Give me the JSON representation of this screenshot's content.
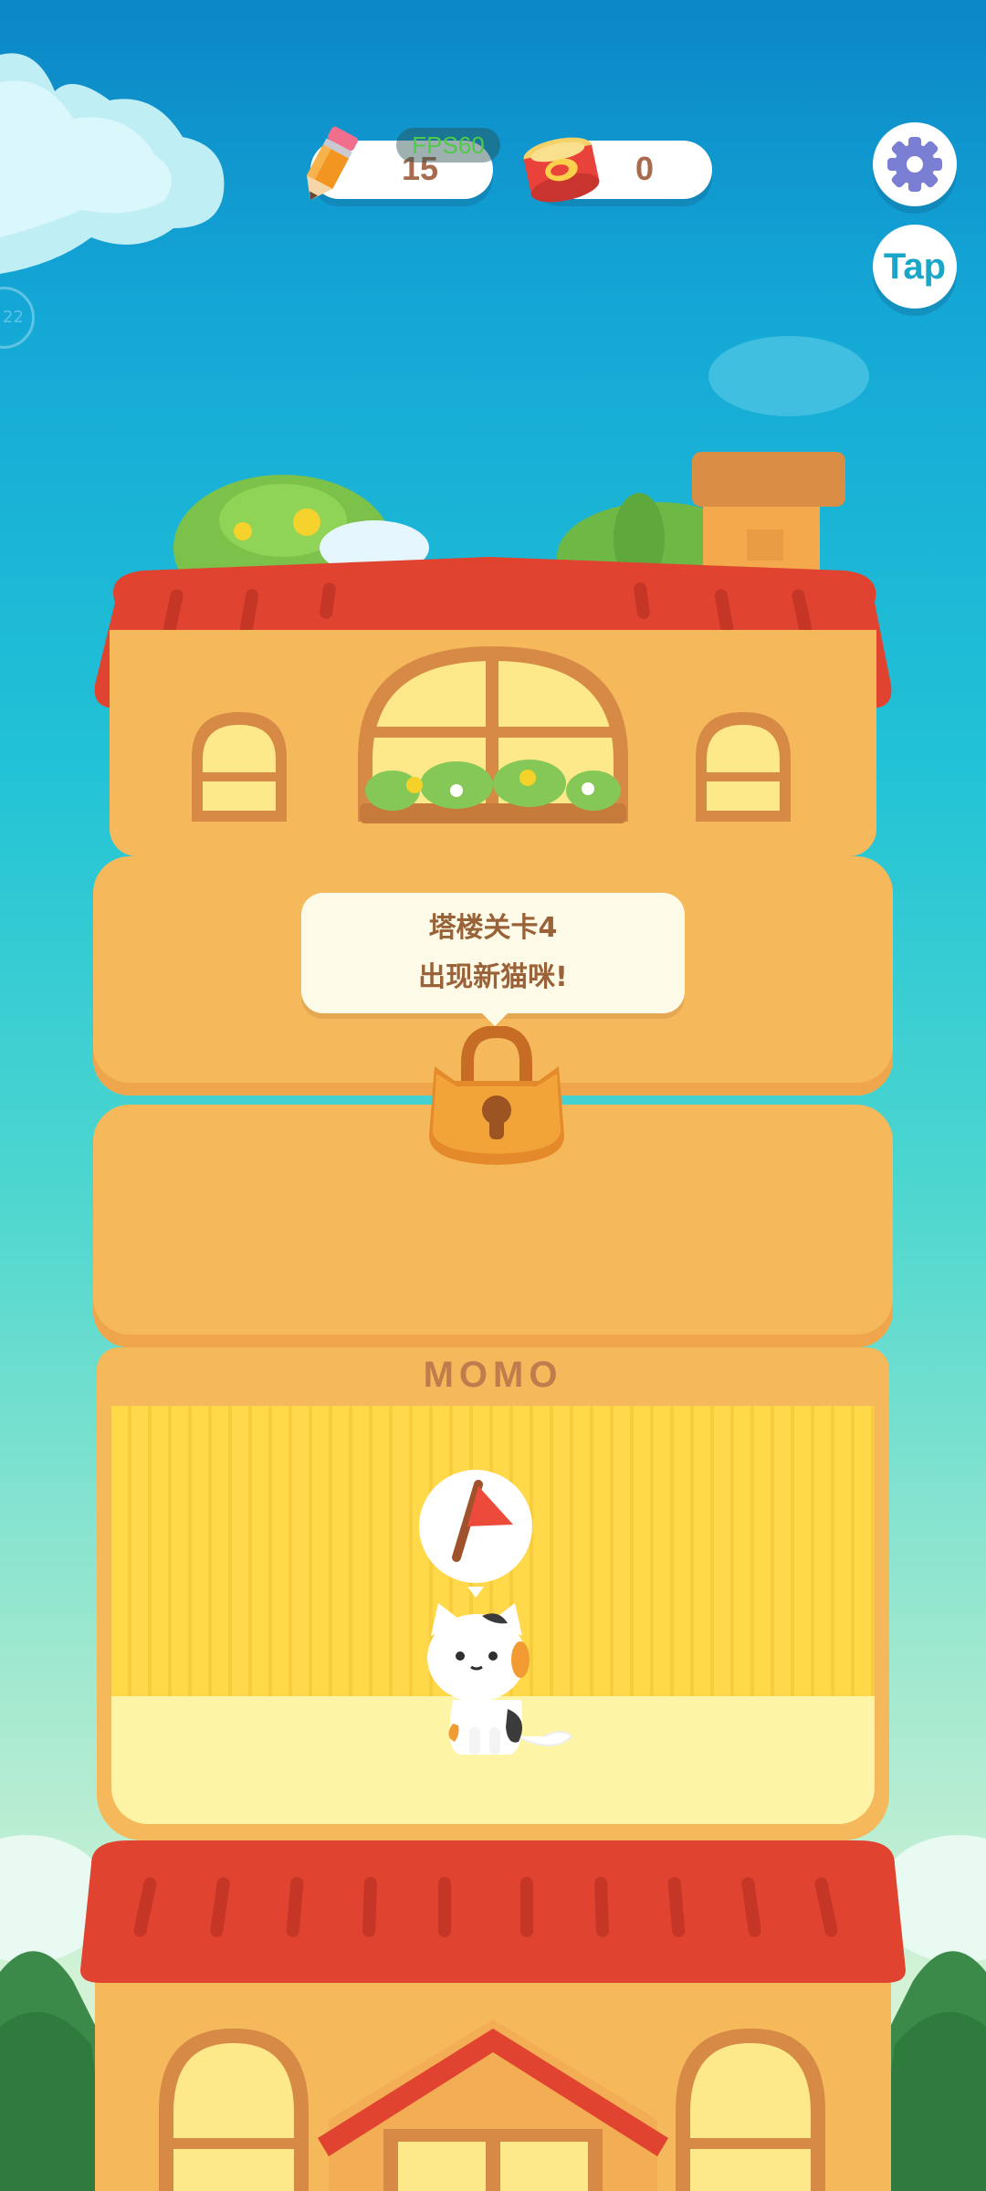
{
  "hud": {
    "pencil_count": "15",
    "fps_label": "FPS60",
    "can_count": "0",
    "tap_label": "Tap",
    "left_badge_label": "22"
  },
  "tower": {
    "locked_floor_bubble": {
      "line1": "塔楼关卡4",
      "line2": "出现新猫咪!"
    },
    "room_sign": "MOMO"
  },
  "colors": {
    "sky_top": "#0b86c6",
    "sky_bottom": "#e8f6e0",
    "roof_red": "#e0432f",
    "wall_orange": "#f5b95b",
    "room_yellow": "#ffd94a",
    "accent_brown": "#a76b4d"
  },
  "icons": [
    "pencil-icon",
    "cat-food-can-icon",
    "gear-icon",
    "lock-icon",
    "red-flag-icon",
    "cat-character"
  ]
}
